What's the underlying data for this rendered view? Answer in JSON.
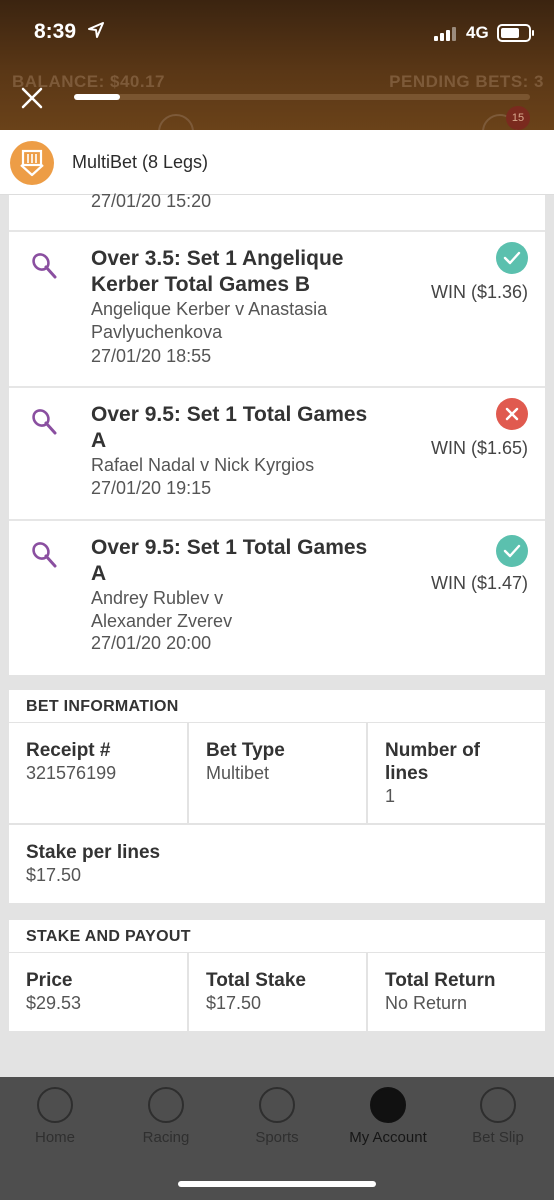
{
  "status": {
    "time": "8:39",
    "network": "4G"
  },
  "header": {
    "balance": "BALANCE: $40.17",
    "pending": "PENDING BETS: 3",
    "badge": "15",
    "progress": 0.1
  },
  "multibet": {
    "title": "MultiBet (8 Legs)",
    "top_date": "27/01/20 15:20"
  },
  "legs": [
    {
      "title": "Over 3.5: Set 1 Angelique Kerber Total Games B",
      "match": "Angelique Kerber v Anastasia Pavlyuchenkova",
      "date": "27/01/20 18:55",
      "result": "WIN ($1.36)",
      "status": "won"
    },
    {
      "title": "Over 9.5: Set 1 Total Games A",
      "match": "Rafael Nadal v Nick Kyrgios",
      "date": "27/01/20 19:15",
      "result": "WIN ($1.65)",
      "status": "lost"
    },
    {
      "title": "Over 9.5: Set 1 Total Games A",
      "match": "Andrey Rublev v Alexander Zverev",
      "date": "27/01/20 20:00",
      "result": "WIN ($1.47)",
      "status": "won"
    }
  ],
  "bet_info": {
    "heading": "BET INFORMATION",
    "receipt_label": "Receipt #",
    "receipt_value": "321576199",
    "type_label": "Bet Type",
    "type_value": "Multibet",
    "lines_label": "Number of lines",
    "lines_value": "1",
    "stake_label": "Stake per lines",
    "stake_value": "$17.50"
  },
  "payout": {
    "heading": "STAKE AND PAYOUT",
    "price_label": "Price",
    "price_value": "$29.53",
    "total_stake_label": "Total Stake",
    "total_stake_value": "$17.50",
    "total_return_label": "Total Return",
    "total_return_value": "No Return"
  },
  "nav": [
    {
      "label": "Home",
      "icon": "home-icon"
    },
    {
      "label": "Racing",
      "icon": "horse-icon"
    },
    {
      "label": "Sports",
      "icon": "ball-icon"
    },
    {
      "label": "My Account",
      "icon": "account-icon",
      "active": true
    },
    {
      "label": "Bet Slip",
      "icon": "betslip-icon"
    }
  ],
  "colors": {
    "accent": "#ed9d46",
    "won": "#5bc0ae",
    "lost": "#e05a4f",
    "racket": "#8a4fa0"
  }
}
